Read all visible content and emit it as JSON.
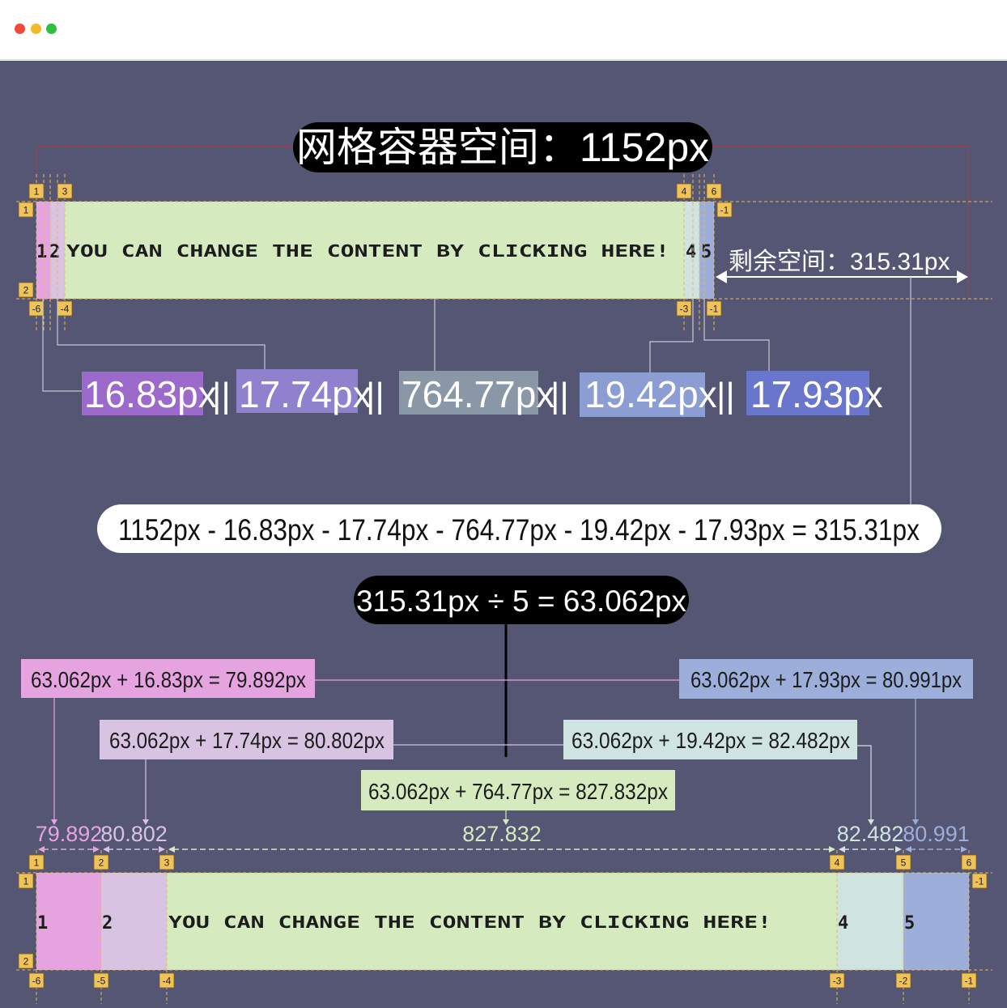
{
  "window": {
    "controls": [
      {
        "name": "close",
        "color": "#ee4b3d"
      },
      {
        "name": "minimize",
        "color": "#f3b92b"
      },
      {
        "name": "maximize",
        "color": "#2cc23f"
      }
    ]
  },
  "colors": {
    "background": "#555674",
    "col1": "#e5a4e0",
    "col2": "#d8c4e2",
    "col3": "#d5eabe",
    "col4": "#cfe3e0",
    "col5": "#9daedb",
    "badge": "#f0c35a"
  },
  "title": "网格容器空间：1152px",
  "remaining": "剩余空间：315.31px",
  "grid_content": {
    "col1": "1",
    "col2": "2",
    "main": "YOU CAN CHANGE THE CONTENT BY CLICKING HERE!",
    "col4": "4",
    "col5": "5"
  },
  "sizes": [
    {
      "text": "16.83px",
      "color": "#9c6acb"
    },
    {
      "text": "17.74px",
      "color": "#8f81cd"
    },
    {
      "text": "764.77px",
      "color": "#8a97a6"
    },
    {
      "text": "19.42px",
      "color": "#8b9dd3"
    },
    {
      "text": "17.93px",
      "color": "#6a76cc"
    }
  ],
  "separator": "||",
  "formula": "1152px - 16.83px - 17.74px - 764.77px - 19.42px - 17.93px = 315.31px",
  "division": "315.31px ÷ 5 = 63.062px",
  "sums": {
    "c1": "63.062px + 16.83px = 79.892px",
    "c2": "63.062px + 17.74px = 80.802px",
    "c3": "63.062px + 764.77px = 827.832px",
    "c4": "63.062px + 19.42px = 82.482px",
    "c5": "63.062px + 17.93px = 80.991px"
  },
  "widths": [
    "79.892",
    "80.802",
    "827.832",
    "82.482",
    "80.991"
  ],
  "top_lines": {
    "col_pos": [
      "1",
      "3",
      "4",
      "6"
    ],
    "col_neg": [
      "-6",
      "-4",
      "-3",
      "-1"
    ],
    "row_pos": [
      "1",
      "2"
    ],
    "row_neg": [
      "-1"
    ]
  },
  "bottom_lines": {
    "col_pos": [
      "1",
      "2",
      "3",
      "4",
      "5",
      "6"
    ],
    "col_neg": [
      "-6",
      "-5",
      "-4",
      "-3",
      "-2",
      "-1"
    ],
    "row_pos": [
      "1",
      "2"
    ],
    "row_neg": [
      "-1"
    ]
  }
}
